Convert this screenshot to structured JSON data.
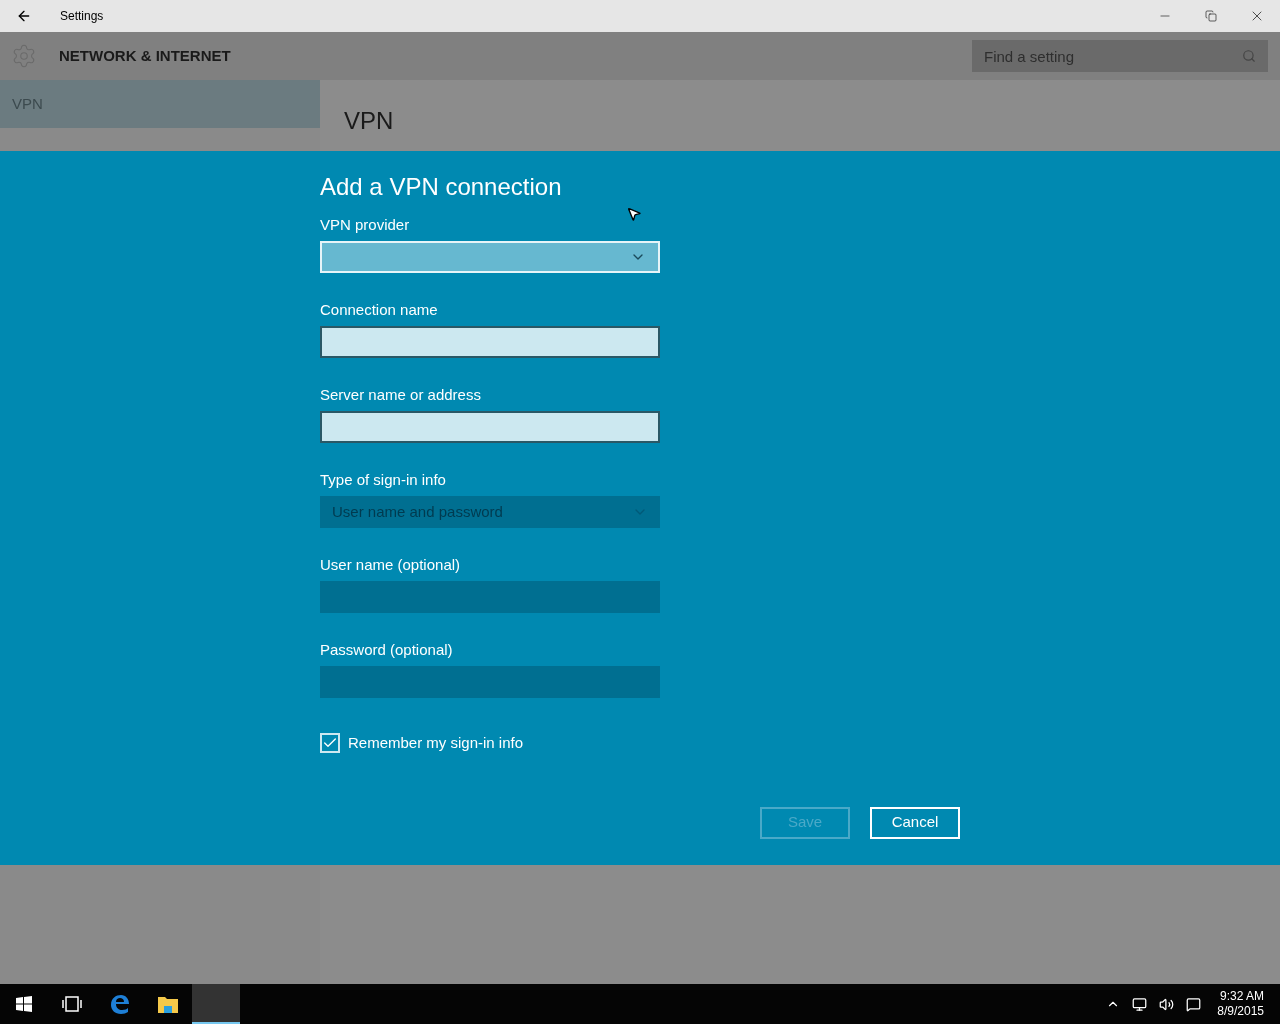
{
  "window": {
    "title": "Settings"
  },
  "header": {
    "title": "NETWORK & INTERNET",
    "search": {
      "placeholder": "Find a setting"
    }
  },
  "sidebar": {
    "items": [
      {
        "label": "VPN",
        "selected": true
      }
    ]
  },
  "page": {
    "title": "VPN"
  },
  "dialog": {
    "title": "Add a VPN connection",
    "fields": [
      {
        "kind": "dropdown",
        "label": "VPN provider",
        "disabled": false
      },
      {
        "kind": "text",
        "label": "Connection name",
        "disabled": false
      },
      {
        "kind": "text",
        "label": "Server name or address",
        "disabled": false
      },
      {
        "kind": "dropdown",
        "label": "Type of sign-in info",
        "value": "User name and password",
        "disabled": true
      },
      {
        "kind": "text",
        "label": "User name (optional)",
        "disabled": true
      },
      {
        "kind": "text",
        "label": "Password (optional)",
        "disabled": true
      }
    ],
    "remember": {
      "label": "Remember my sign-in info",
      "checked": true
    },
    "buttons": [
      {
        "label": "Save",
        "disabled": true
      },
      {
        "label": "Cancel",
        "disabled": false
      }
    ]
  },
  "taskbar": {
    "apps": [
      {
        "kind": "taskview",
        "selected": false
      },
      {
        "kind": "edge",
        "selected": false
      },
      {
        "kind": "explorer",
        "selected": false
      },
      {
        "kind": "settings",
        "selected": true
      }
    ],
    "time": "9:32 AM",
    "date": "8/9/2015"
  }
}
